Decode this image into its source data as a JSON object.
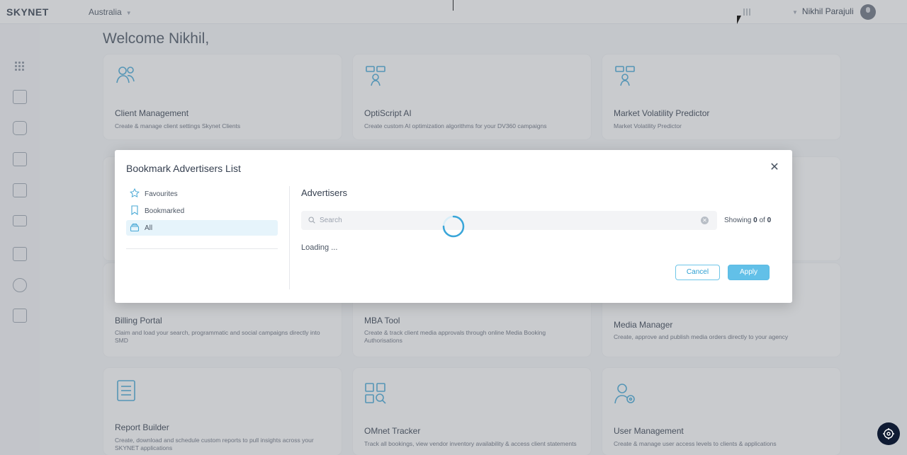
{
  "header": {
    "logo": "SKYNET",
    "country": "Australia",
    "user_name": "Nikhil Parajuli"
  },
  "main": {
    "welcome": "Welcome Nikhil,",
    "cards": [
      {
        "title": "Client Management",
        "desc": "Create & manage client settings Skynet Clients",
        "icon": "users-icon"
      },
      {
        "title": "OptiScript AI",
        "desc": "Create custom AI optimization algorithms for your DV360 campaigns",
        "icon": "ai-script-icon"
      },
      {
        "title": "Market Volatility Predictor",
        "desc": "Market Volatility Predictor",
        "icon": "predictor-icon"
      },
      {
        "title": "Billing Portal",
        "desc": "Claim and load your search, programmatic and social campaigns directly into SMD",
        "icon": "billing-icon"
      },
      {
        "title": "MBA Tool",
        "desc": "Create & track client media approvals through online Media Booking Authorisations",
        "icon": "mba-icon"
      },
      {
        "title": "Media Manager",
        "desc": "Create, approve and publish media orders directly to your agency",
        "icon": "media-icon"
      },
      {
        "title": "Report Builder",
        "desc": "Create, download and schedule custom reports to pull insights across your SKYNET applications",
        "icon": "report-icon"
      },
      {
        "title": "OMnet Tracker",
        "desc": "Track all bookings, view vendor inventory availability & access client statements",
        "icon": "tracker-icon"
      },
      {
        "title": "User Management",
        "desc": "Create & manage user access levels to clients & applications",
        "icon": "user-settings-icon"
      }
    ]
  },
  "modal": {
    "title": "Bookmark Advertisers List",
    "lists": [
      {
        "label": "Favourites",
        "icon": "star-icon"
      },
      {
        "label": "Bookmarked",
        "icon": "bookmark-icon"
      },
      {
        "label": "All",
        "icon": "stack-icon"
      }
    ],
    "active_list": "All",
    "advertisers_title": "Advertisers",
    "search_placeholder": "Search",
    "showing_label": "Showing",
    "showing_count": "0",
    "showing_of": "of",
    "showing_total": "0",
    "loading_text": "Loading ...",
    "cancel_label": "Cancel",
    "apply_label": "Apply"
  },
  "colors": {
    "accent": "#2c9fd2",
    "apply_bg": "#62c0e8",
    "active_row": "#e6f4fb",
    "help_button": "#0f1b33"
  }
}
